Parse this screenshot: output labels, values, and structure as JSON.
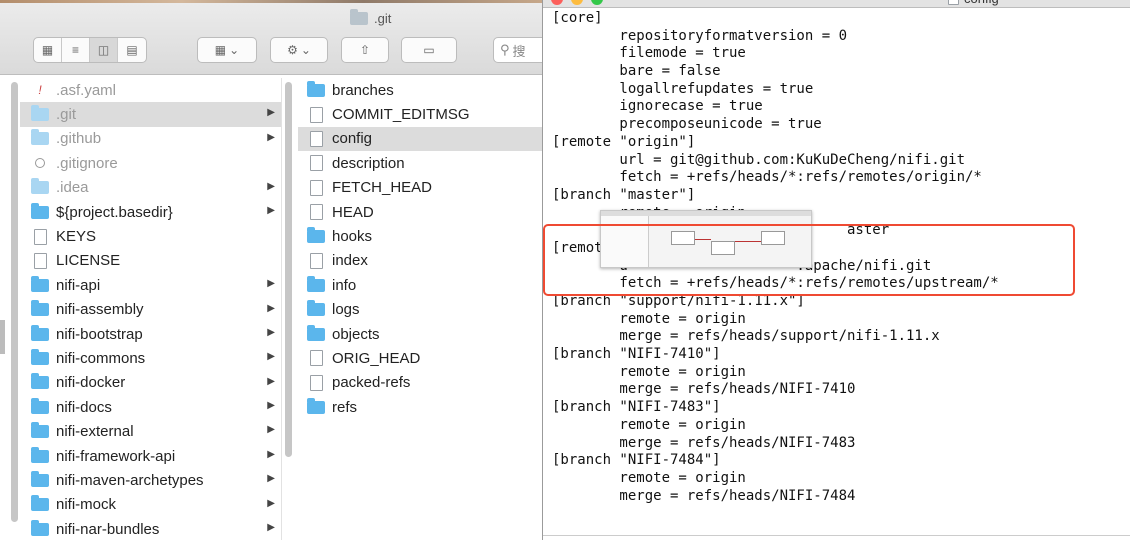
{
  "finder": {
    "title": ".git",
    "search_placeholder": "搜",
    "sidebar_items": [
      {
        "label": ".asf.yaml",
        "icon": "yaml-file-icon",
        "dim": true,
        "has_children": false
      },
      {
        "label": ".git",
        "icon": "folder-icon",
        "dim": true,
        "has_children": true,
        "selected": true
      },
      {
        "label": ".github",
        "icon": "folder-icon",
        "dim": true,
        "has_children": true
      },
      {
        "label": ".gitignore",
        "icon": "gitignore-file-icon",
        "dim": true,
        "has_children": false
      },
      {
        "label": ".idea",
        "icon": "folder-icon",
        "dim": true,
        "has_children": true
      },
      {
        "label": "${project.basedir}",
        "icon": "folder-icon",
        "dim": false,
        "has_children": true
      },
      {
        "label": "KEYS",
        "icon": "document-icon",
        "dim": false,
        "has_children": false
      },
      {
        "label": "LICENSE",
        "icon": "document-icon",
        "dim": false,
        "has_children": false
      },
      {
        "label": "nifi-api",
        "icon": "folder-icon",
        "dim": false,
        "has_children": true
      },
      {
        "label": "nifi-assembly",
        "icon": "folder-icon",
        "dim": false,
        "has_children": true
      },
      {
        "label": "nifi-bootstrap",
        "icon": "folder-icon",
        "dim": false,
        "has_children": true
      },
      {
        "label": "nifi-commons",
        "icon": "folder-icon",
        "dim": false,
        "has_children": true
      },
      {
        "label": "nifi-docker",
        "icon": "folder-icon",
        "dim": false,
        "has_children": true
      },
      {
        "label": "nifi-docs",
        "icon": "folder-icon",
        "dim": false,
        "has_children": true
      },
      {
        "label": "nifi-external",
        "icon": "folder-icon",
        "dim": false,
        "has_children": true
      },
      {
        "label": "nifi-framework-api",
        "icon": "folder-icon",
        "dim": false,
        "has_children": true
      },
      {
        "label": "nifi-maven-archetypes",
        "icon": "folder-icon",
        "dim": false,
        "has_children": true
      },
      {
        "label": "nifi-mock",
        "icon": "folder-icon",
        "dim": false,
        "has_children": true
      },
      {
        "label": "nifi-nar-bundles",
        "icon": "folder-icon",
        "dim": false,
        "has_children": true
      }
    ],
    "git_items": [
      {
        "label": "branches",
        "icon": "folder-icon"
      },
      {
        "label": "COMMIT_EDITMSG",
        "icon": "document-icon"
      },
      {
        "label": "config",
        "icon": "document-icon",
        "selected": true
      },
      {
        "label": "description",
        "icon": "document-icon"
      },
      {
        "label": "FETCH_HEAD",
        "icon": "document-icon"
      },
      {
        "label": "HEAD",
        "icon": "document-icon"
      },
      {
        "label": "hooks",
        "icon": "folder-icon"
      },
      {
        "label": "index",
        "icon": "document-icon"
      },
      {
        "label": "info",
        "icon": "folder-icon"
      },
      {
        "label": "logs",
        "icon": "folder-icon"
      },
      {
        "label": "objects",
        "icon": "folder-icon"
      },
      {
        "label": "ORIG_HEAD",
        "icon": "document-icon"
      },
      {
        "label": "packed-refs",
        "icon": "document-icon"
      },
      {
        "label": "refs",
        "icon": "folder-icon"
      }
    ]
  },
  "editor": {
    "file_name": "config",
    "lines": [
      "[core]",
      "        repositoryformatversion = 0",
      "        filemode = true",
      "        bare = false",
      "        logallrefupdates = true",
      "        ignorecase = true",
      "        precomposeunicode = true",
      "[remote \"origin\"]",
      "        url = git@github.com:KuKuDeCheng/nifi.git",
      "        fetch = +refs/heads/*:refs/remotes/origin/*",
      "[branch \"master\"]",
      "        remote = origin",
      "        m                          aster",
      "[remote \"",
      "        u                    :apache/nifi.git",
      "        fetch = +refs/heads/*:refs/remotes/upstream/*",
      "[branch \"support/nifi-1.11.x\"]",
      "        remote = origin",
      "        merge = refs/heads/support/nifi-1.11.x",
      "[branch \"NIFI-7410\"]",
      "        remote = origin",
      "        merge = refs/heads/NIFI-7410",
      "[branch \"NIFI-7483\"]",
      "        remote = origin",
      "        merge = refs/heads/NIFI-7483",
      "[branch \"NIFI-7484\"]",
      "        remote = origin",
      "        merge = refs/heads/NIFI-7484"
    ]
  },
  "colors": {
    "folder": "#5bb6ec",
    "highlight_box": "#ef4a32",
    "selection": "#dcdcdc"
  }
}
